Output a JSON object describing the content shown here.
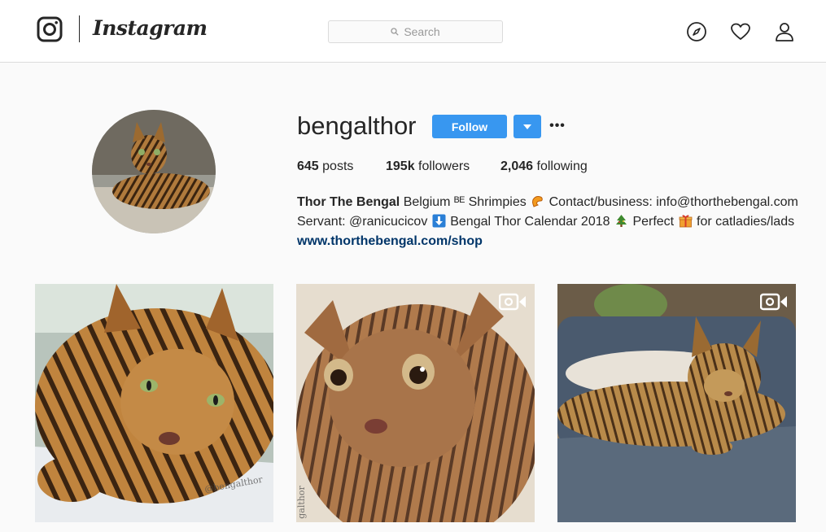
{
  "header": {
    "brand": "Instagram",
    "search_placeholder": "Search",
    "icons": [
      "instagram-logo-icon",
      "search-icon",
      "compass-icon",
      "heart-icon",
      "user-icon"
    ]
  },
  "profile": {
    "username": "bengalthor",
    "follow_label": "Follow",
    "more_label": "•••",
    "stats": {
      "posts_count": "645",
      "posts_label": "posts",
      "followers_count": "195k",
      "followers_label": "followers",
      "following_count": "2,046",
      "following_label": "following"
    },
    "bio": {
      "full_name": "Thor The Bengal",
      "line1_text": "Belgium ᴮᴱ Shrimpies",
      "line1_contact": "Contact/business: info@thorthebengal.com",
      "line2_prefix": "Servant:",
      "line2_handle": "@ranicucicov",
      "line2_calendar": "Bengal Thor Calendar 2018",
      "line2_perfect": "Perfect",
      "line2_tail": "for catladies/lads",
      "website": "www.thorthebengal.com/shop",
      "emojis": [
        "shrimp-emoji",
        "down-arrow-emoji",
        "christmas-tree-emoji",
        "gift-emoji"
      ]
    }
  },
  "grid": {
    "posts": [
      {
        "kind": "photo",
        "watermark": "@bengalthor"
      },
      {
        "kind": "video",
        "watermark": "galthor"
      },
      {
        "kind": "video",
        "watermark": ""
      }
    ]
  },
  "colors": {
    "accent": "#3897f0",
    "link": "#003569",
    "text": "#262626",
    "background": "#fafafa"
  }
}
